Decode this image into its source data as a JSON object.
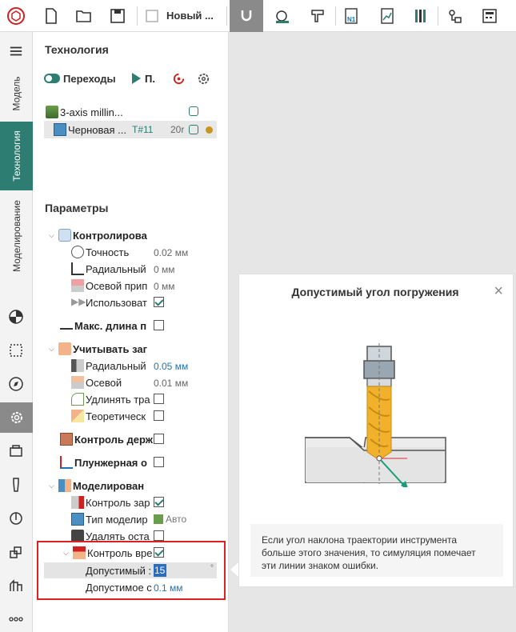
{
  "toolbar": {
    "doc_title": "Новый ..."
  },
  "left_tabs": {
    "model": "Модель",
    "technology": "Технология",
    "modeling": "Моделирование"
  },
  "panel": {
    "title": "Технология",
    "transitions_label": "Переходы",
    "play_label": "П.",
    "tree": {
      "machine": "3-axis millin...",
      "op_name": "Черновая ...",
      "op_tool": "T#11",
      "op_time": "20r"
    },
    "params_title": "Параметры",
    "groups": [
      {
        "label": "Контролирова",
        "items": [
          {
            "label": "Точность",
            "value": "0.02 мм"
          },
          {
            "label": "Радиальный",
            "value": "0 мм"
          },
          {
            "label": "Осевой прип",
            "value": "0 мм"
          },
          {
            "label": "Использоват"
          }
        ]
      },
      {
        "label": "Макс. длина п"
      },
      {
        "label": "Учитывать заг",
        "items": [
          {
            "label": "Радиальный",
            "value": "0.05 мм"
          },
          {
            "label": "Осевой",
            "value": "0.01 мм"
          },
          {
            "label": "Удлинять тра"
          },
          {
            "label": "Теоретическ"
          }
        ]
      },
      {
        "label": "Контроль держ"
      },
      {
        "label": "Плунжерная о"
      },
      {
        "label": "Моделирован",
        "items": [
          {
            "label": "Контроль зар"
          },
          {
            "label": "Тип моделир",
            "value": "Авто"
          },
          {
            "label": "Удалять оста"
          },
          {
            "label": "Контроль вре"
          }
        ]
      }
    ],
    "angle_label": "Допустимый :",
    "angle_value": "15",
    "angle_unit": "°",
    "tol_label": "Допустимое с",
    "tol_value": "0.1 мм"
  },
  "popup": {
    "title": "Допустимый угол погружения",
    "text": "Если угол наклона траектории инструмента больше этого значения, то симуляция помечает эти линии знаком ошибки."
  },
  "colors": {
    "accent": "#2e7d73",
    "highlight": "#e02020",
    "blue_value": "#1a73b8"
  }
}
